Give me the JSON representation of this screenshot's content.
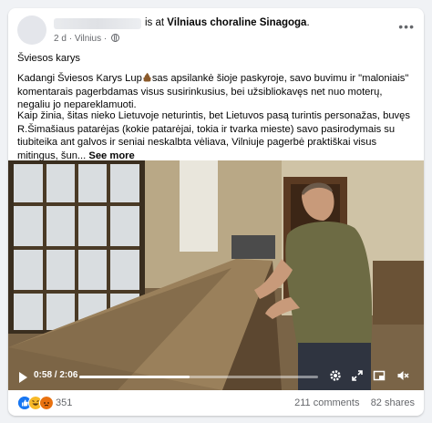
{
  "post": {
    "location_prefix": "is at",
    "location": "Vilniaus choraline Sinagoga",
    "location_suffix": ".",
    "age": "2 d",
    "place": "Vilnius",
    "sep": "·",
    "para1": "Šviesos karys",
    "para2_a": "Kadangi Šviesos Karys Lup",
    "para2_b": "sas apsilankė šioje paskyroje, savo buvimu ir \"maloniais\" komentarais pagerbdamas visus susirinkusius, bei užsibliokavęs net nuo moterų, negaliu jo nepareklamuoti.",
    "para3": "Kaip žinia, šitas nieko Lietuvoje neturintis, bet Lietuvos pasą turintis personažas, buvęs R.Šimašiaus patarėjas (kokie patarėjai, tokia ir tvarka mieste) savo pasirodymais su tiubiteika ant galvos ir seniai neskalbta vėliava, Vilniuje pagerbė praktiškai visus mitingus, šun...",
    "see_more": "See more"
  },
  "video": {
    "time_current": "0:58",
    "time_sep": "/",
    "time_total": "2:06",
    "progress": 0.46
  },
  "footer": {
    "reaction_count": "351",
    "comments": "211 comments",
    "shares": "82 shares"
  },
  "colors": {
    "brand_blue": "#1877f2",
    "like_blue": "#1877f2",
    "haha_yellow": "#f7b928",
    "angry_orange": "#e9710f"
  },
  "icons": [
    "more-options-icon",
    "globe-icon",
    "play-icon",
    "settings-icon",
    "expand-icon",
    "pip-icon",
    "mute-icon",
    "like-reaction-icon",
    "haha-reaction-icon",
    "angry-reaction-icon",
    "poop-emoji-icon"
  ]
}
